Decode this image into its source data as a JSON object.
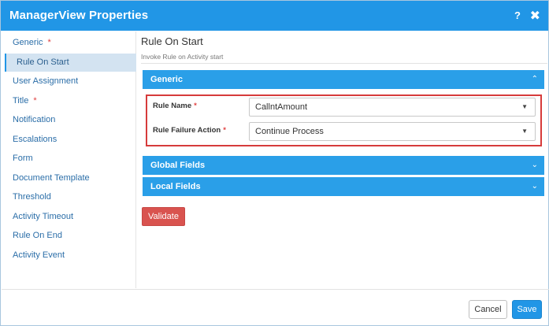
{
  "dialog": {
    "title": "ManagerView Properties",
    "help_glyph": "?",
    "close_glyph": "✖"
  },
  "sidebar": {
    "items": [
      {
        "label": "Generic",
        "required": "*"
      },
      {
        "label": "Rule On Start",
        "required": ""
      },
      {
        "label": "User Assignment",
        "required": ""
      },
      {
        "label": "Title",
        "required": "*"
      },
      {
        "label": "Notification",
        "required": ""
      },
      {
        "label": "Escalations",
        "required": ""
      },
      {
        "label": "Form",
        "required": ""
      },
      {
        "label": "Document Template",
        "required": ""
      },
      {
        "label": "Threshold",
        "required": ""
      },
      {
        "label": "Activity Timeout",
        "required": ""
      },
      {
        "label": "Rule On End",
        "required": ""
      },
      {
        "label": "Activity Event",
        "required": ""
      }
    ],
    "active_item": "Rule On Start"
  },
  "main": {
    "title": "Rule On Start",
    "subtitle": "Invoke Rule on Activity start",
    "panels": [
      {
        "label": "Generic",
        "chevron": "⌃",
        "expanded": true
      },
      {
        "label": "Global Fields",
        "chevron": "⌄",
        "expanded": false
      },
      {
        "label": "Local Fields",
        "chevron": "⌄",
        "expanded": false
      }
    ],
    "fields": [
      {
        "label": "Rule Name",
        "required": "*",
        "value": "CallntAmount"
      },
      {
        "label": "Rule Failure Action",
        "required": "*",
        "value": "Continue Process"
      }
    ],
    "caret_glyph": "▼",
    "validate_label": "Validate"
  },
  "footer": {
    "cancel_label": "Cancel",
    "save_label": "Save"
  },
  "colors": {
    "primary": "#2196e6",
    "panel_header": "#2a9fe8",
    "danger": "#d9534f",
    "highlight_border": "#d63b3b",
    "active_nav_bg": "#d3e3f1"
  },
  "icons": {
    "help": "help-icon",
    "close": "close-icon",
    "chevron_up": "chevron-up-icon",
    "chevron_down": "chevron-down-icon",
    "dropdown_caret": "dropdown-caret-icon"
  }
}
